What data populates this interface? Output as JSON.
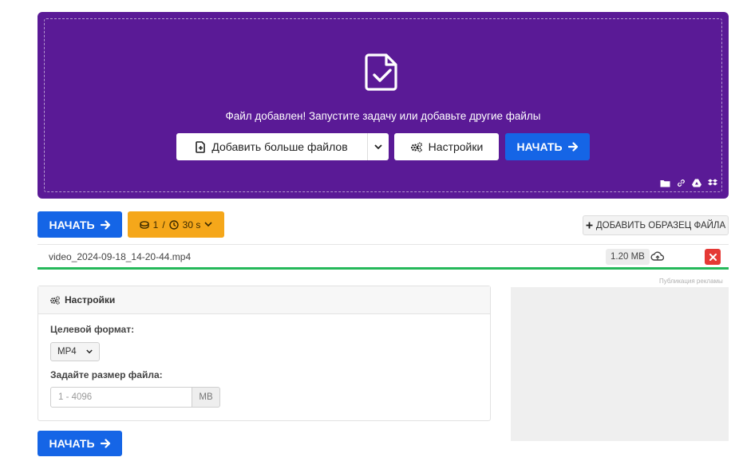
{
  "upload": {
    "message": "Файл добавлен! Запустите задачу или добавьте другие файлы",
    "add_more_label": "Добавить больше файлов",
    "settings_label": "Настройки",
    "start_label": "НАЧАТЬ",
    "source_icons": [
      "folder-icon",
      "link-icon",
      "google-drive-icon",
      "dropbox-icon"
    ]
  },
  "toolbar": {
    "start_label": "НАЧАТЬ",
    "files_count": "1",
    "separator": "/",
    "time_limit": "30 s",
    "add_sample_label": "ДОБАВИТЬ ОБРАЗЕЦ ФАЙЛА"
  },
  "file": {
    "name": "video_2024-09-18_14-20-44.mp4",
    "size": "1.20 MB",
    "progress": 1.0
  },
  "ad": {
    "label": "Публикация рекламы"
  },
  "settings": {
    "title": "Настройки",
    "target_format_label": "Целевой формат:",
    "target_format_value": "MP4",
    "file_size_label": "Задайте размер файла:",
    "file_size_placeholder": "1 - 4096",
    "file_size_unit": "MB"
  },
  "bottom": {
    "start_label": "НАЧАТЬ"
  },
  "colors": {
    "panel": "#5a1a96",
    "primary": "#1565e6",
    "warning": "#f5a71a",
    "success": "#25b85a",
    "danger": "#e53935"
  }
}
